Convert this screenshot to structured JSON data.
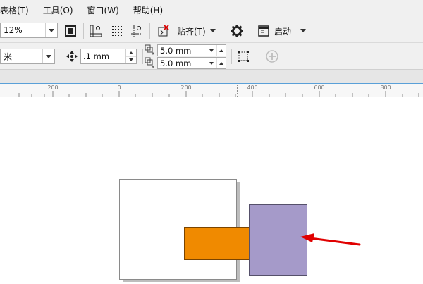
{
  "menu": [
    {
      "label": "表格(T)"
    },
    {
      "label": "工具(O)"
    },
    {
      "label": "窗口(W)"
    },
    {
      "label": "帮助(H)"
    }
  ],
  "toolbar1": {
    "zoom_value": "12%",
    "snap_label": "贴齐(T)",
    "launch_label": "启动",
    "icons": [
      "fullscreen-icon",
      "ruler-icon",
      "grid-icon",
      "guideline-icon",
      "snap-off-icon",
      "gear-icon",
      "launch-window-icon"
    ]
  },
  "toolbar2": {
    "units_value": "米",
    "nudge_value": ".1 mm",
    "duplicate_x": "5.0 mm",
    "duplicate_y": "5.0 mm",
    "icons": [
      "nudge-icon",
      "dup-x-icon",
      "dup-y-icon",
      "page-frame-icon",
      "add-icon"
    ]
  },
  "ruler": {
    "ticks": [
      "200",
      "0",
      "200",
      "400",
      "600",
      "800"
    ]
  },
  "canvas": {
    "page_color": "#ffffff",
    "orange_color": "#f08a00",
    "purple_color": "#a59ac9",
    "arrow_color": "#e00000"
  }
}
